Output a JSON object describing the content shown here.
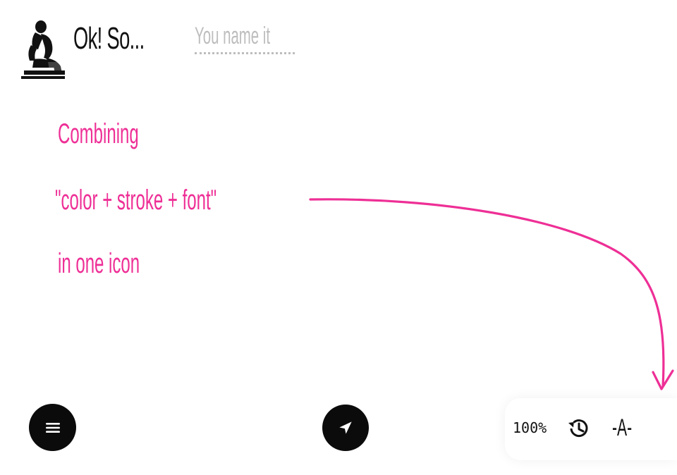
{
  "header": {
    "title": "Ok! So...",
    "name_value": "You name it"
  },
  "content": {
    "lines": [
      "Combining",
      "\"color + stroke + font\"",
      "in one icon"
    ]
  },
  "toolbar": {
    "zoom": "100%",
    "font_label": "-A-"
  },
  "icons": {
    "logo": "thinker-statue-icon",
    "menu": "hamburger-menu-icon",
    "navigate": "navigation-arrow-icon",
    "history": "history-icon",
    "font": "font-style-icon"
  },
  "colors": {
    "accent": "#ee2f96",
    "dark": "#0b0b0b",
    "placeholder": "#bdbdbd"
  }
}
